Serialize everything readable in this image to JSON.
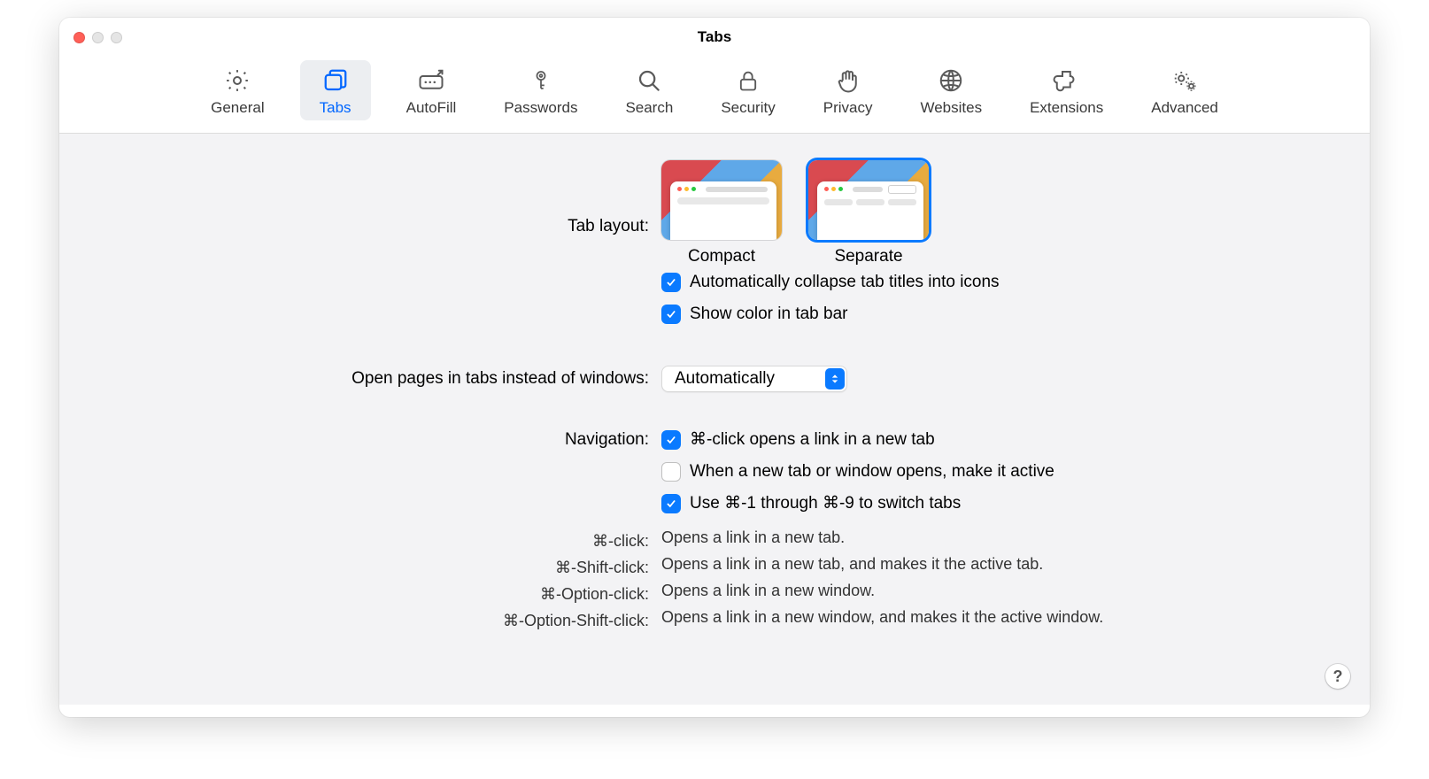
{
  "window_title": "Tabs",
  "toolbar": [
    {
      "id": "general",
      "label": "General"
    },
    {
      "id": "tabs",
      "label": "Tabs"
    },
    {
      "id": "autofill",
      "label": "AutoFill"
    },
    {
      "id": "passwords",
      "label": "Passwords"
    },
    {
      "id": "search",
      "label": "Search"
    },
    {
      "id": "security",
      "label": "Security"
    },
    {
      "id": "privacy",
      "label": "Privacy"
    },
    {
      "id": "websites",
      "label": "Websites"
    },
    {
      "id": "extensions",
      "label": "Extensions"
    },
    {
      "id": "advanced",
      "label": "Advanced"
    }
  ],
  "active_tab": "tabs",
  "tab_layout": {
    "label": "Tab layout:",
    "options": {
      "compact": "Compact",
      "separate": "Separate"
    },
    "selected": "separate"
  },
  "checkboxes": {
    "collapse": {
      "label": "Automatically collapse tab titles into icons",
      "checked": true
    },
    "color": {
      "label": "Show color in tab bar",
      "checked": true
    },
    "cmdclick": {
      "label": "⌘-click opens a link in a new tab",
      "checked": true
    },
    "active": {
      "label": "When a new tab or window opens, make it active",
      "checked": false
    },
    "switch": {
      "label": "Use ⌘-1 through ⌘-9 to switch tabs",
      "checked": true
    }
  },
  "open_pages": {
    "label": "Open pages in tabs instead of windows:",
    "value": "Automatically"
  },
  "navigation_label": "Navigation:",
  "descriptions": [
    {
      "k": "⌘-click:",
      "v": "Opens a link in a new tab."
    },
    {
      "k": "⌘-Shift-click:",
      "v": "Opens a link in a new tab, and makes it the active tab."
    },
    {
      "k": "⌘-Option-click:",
      "v": "Opens a link in a new window."
    },
    {
      "k": "⌘-Option-Shift-click:",
      "v": "Opens a link in a new window, and makes it the active window."
    }
  ],
  "help": "?"
}
